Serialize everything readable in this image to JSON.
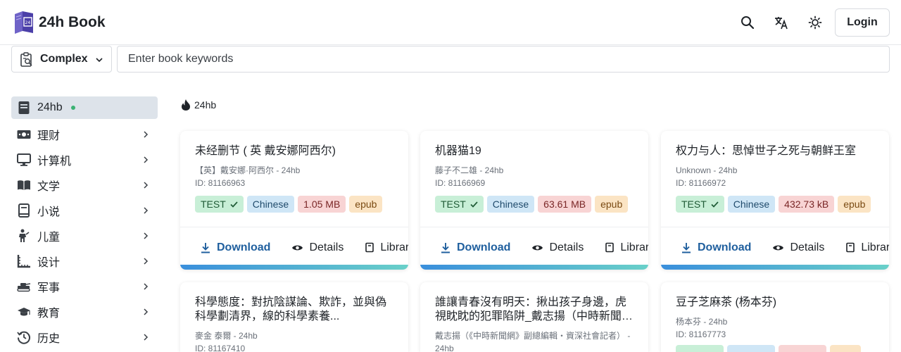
{
  "header": {
    "brand": "24h Book",
    "login_label": "Login",
    "icons": [
      "search-icon",
      "translate-icon",
      "theme-icon"
    ]
  },
  "search": {
    "mode_label": "Complex",
    "placeholder": "Enter book keywords",
    "value": ""
  },
  "sidebar": {
    "items": [
      {
        "label": "24hb",
        "icon": "book-icon",
        "active": true
      },
      {
        "label": "理财",
        "icon": "money-icon"
      },
      {
        "label": "计算机",
        "icon": "monitor-icon"
      },
      {
        "label": "文学",
        "icon": "open-book-icon"
      },
      {
        "label": "小说",
        "icon": "book-icon"
      },
      {
        "label": "儿童",
        "icon": "child-icon"
      },
      {
        "label": "设计",
        "icon": "ruler-icon"
      },
      {
        "label": "军事",
        "icon": "tank-icon"
      },
      {
        "label": "教育",
        "icon": "graduation-cap-icon"
      },
      {
        "label": "历史",
        "icon": "history-icon"
      }
    ]
  },
  "main": {
    "section_title": "24hb",
    "actions": {
      "download": "Download",
      "details": "Details",
      "library": "Library"
    },
    "books": [
      {
        "title": "未经删节 ( 英 戴安娜阿西尔)",
        "author": "【英】戴安娜·阿西尔 - 24hb",
        "id": "ID: 81166963",
        "tag": "TEST",
        "language": "Chinese",
        "size": "1.05 MB",
        "format": "epub"
      },
      {
        "title": "机器猫19",
        "author": "藤子不二雄 - 24hb",
        "id": "ID: 81166969",
        "tag": "TEST",
        "language": "Chinese",
        "size": "63.61 MB",
        "format": "epub"
      },
      {
        "title": "权力与人：思悼世子之死与朝鲜王室",
        "author": "Unknown - 24hb",
        "id": "ID: 81166972",
        "tag": "TEST",
        "language": "Chinese",
        "size": "432.73 kB",
        "format": "epub"
      },
      {
        "title": "科學態度：對抗陰謀論、欺詐，並與偽科學劃清界，線的科學素養...",
        "author": "麥金 泰爾 - 24hb",
        "id": "ID: 81167410"
      },
      {
        "title": "誰讓青春沒有明天：揪出孩子身邊，虎視眈眈的犯罪陷阱_戴志揚（中時新聞網）",
        "author": "戴志揚（《中時新聞網》副總編輯‧資深社會記者） - 24hb",
        "id": ""
      },
      {
        "title": "豆子芝麻茶 (杨本芬)",
        "author": "杨本芬 - 24hb",
        "id": "ID: 81167773"
      }
    ]
  },
  "colors": {
    "accent": "#1f5f9e",
    "active_bg": "#dde3ea",
    "stripe_start": "#3a8fdc",
    "stripe_end": "#69d0c9"
  }
}
